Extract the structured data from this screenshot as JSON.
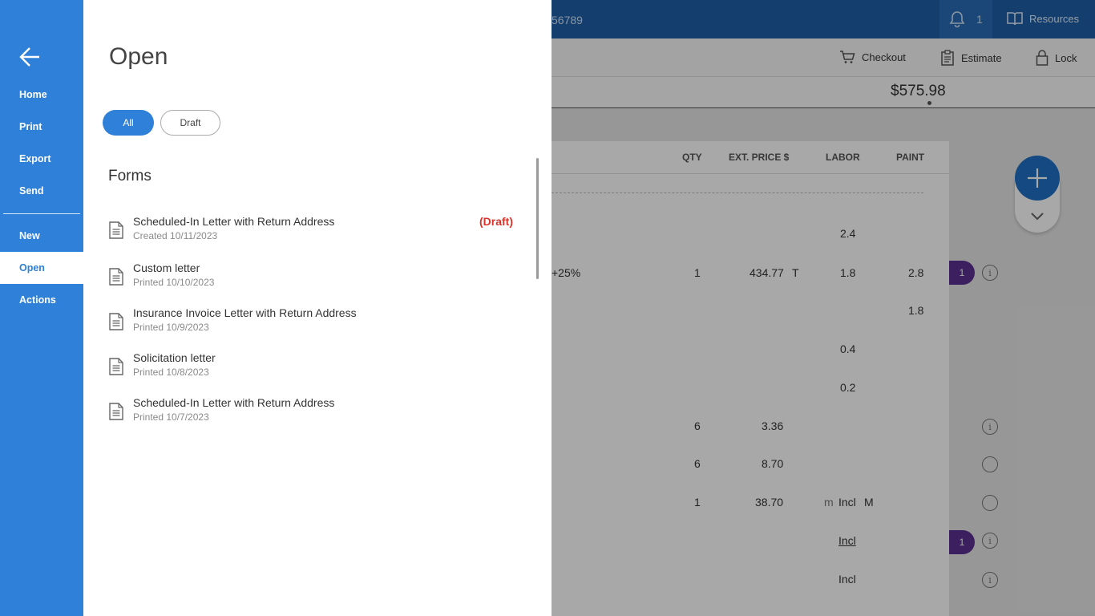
{
  "app": {
    "ro_fragment": "56789",
    "notifications_count": "1",
    "resources_label": "Resources",
    "toolbar": {
      "checkout": "Checkout",
      "estimate": "Estimate",
      "lock": "Lock"
    },
    "total": "$575.98",
    "table": {
      "headers": {
        "qty": "QTY",
        "ext_price": "EXT. PRICE $",
        "labor": "LABOR",
        "paint": "PAINT"
      },
      "cells": {
        "r1_labor": "2.4",
        "r2_desc": "+25%",
        "r2_qty": "1",
        "r2_price": "434.77",
        "r2_tax": "T",
        "r2_labor": "1.8",
        "r2_paint": "2.8",
        "r2_badge": "1",
        "r3_paint": "1.8",
        "r4_labor": "0.4",
        "r5_labor": "0.2",
        "r6_qty": "6",
        "r6_price": "3.36",
        "r7_qty": "6",
        "r7_price": "8.70",
        "r8_qty": "1",
        "r8_price": "38.70",
        "r8_m1": "m",
        "r8_labor": "Incl",
        "r8_m2": "M",
        "r9_labor": "Incl",
        "r9_badge": "1",
        "r10_labor": "Incl",
        "info_glyph": "i"
      }
    }
  },
  "nav": {
    "items": [
      {
        "label": "Home"
      },
      {
        "label": "Print"
      },
      {
        "label": "Export"
      },
      {
        "label": "Send"
      },
      {
        "label": "New"
      },
      {
        "label": "Open"
      },
      {
        "label": "Actions"
      }
    ]
  },
  "panel": {
    "title": "Open",
    "filters": {
      "all": "All",
      "draft": "Draft"
    },
    "section": "Forms",
    "forms": [
      {
        "name": "Scheduled-In Letter with Return Address",
        "sub": "Created 10/11/2023",
        "status": "(Draft)"
      },
      {
        "name": "Custom letter",
        "sub": "Printed 10/10/2023"
      },
      {
        "name": "Insurance Invoice Letter with Return Address",
        "sub": "Printed 10/9/2023"
      },
      {
        "name": "Solicitation letter",
        "sub": "Printed 10/8/2023"
      },
      {
        "name": "Scheduled-In Letter with Return Address",
        "sub": "Printed 10/7/2023"
      }
    ]
  }
}
